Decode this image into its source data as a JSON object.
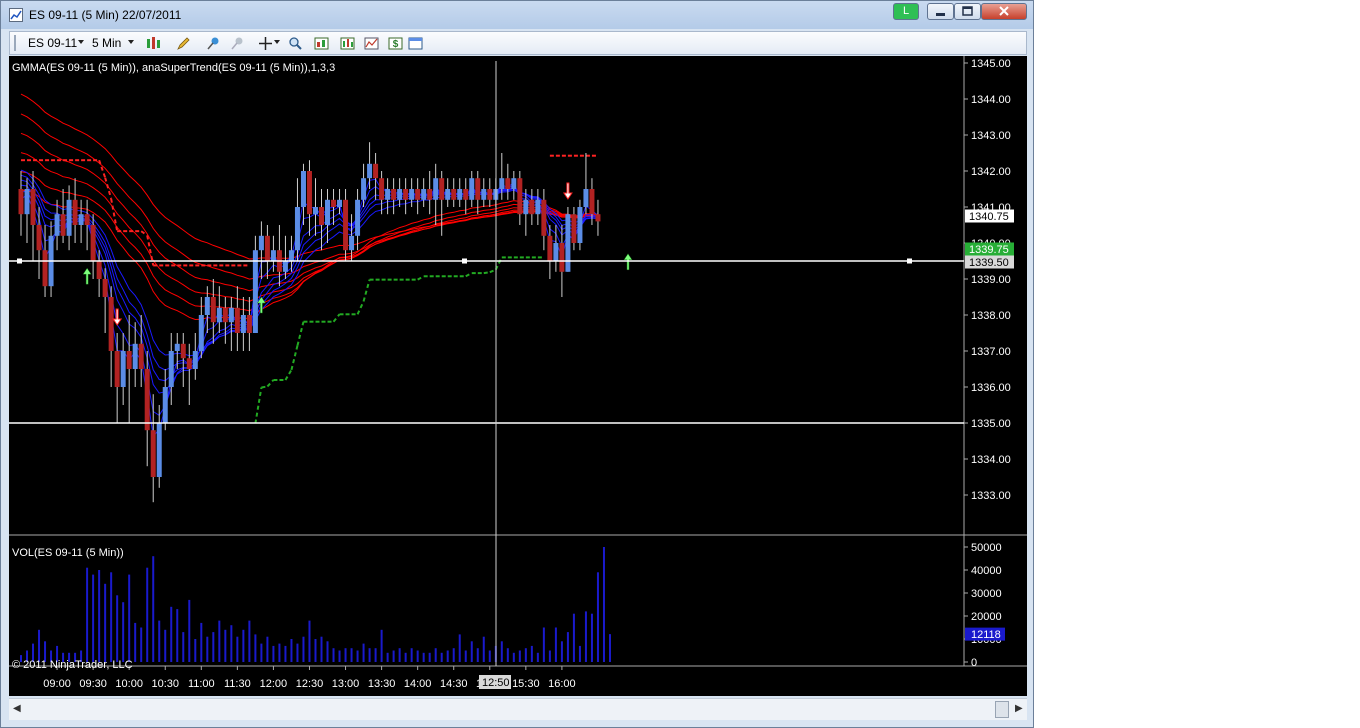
{
  "window": {
    "title": "ES 09-11 (5 Min)  22/07/2011",
    "link_button": "L",
    "min_icon": "minimize-icon",
    "max_icon": "maximize-icon",
    "close_icon": "close-icon"
  },
  "toolbar": {
    "instrument": "ES 09-11",
    "interval": "5 Min",
    "icons": [
      "bar-style-icon",
      "pencil-icon",
      "pin-icon",
      "pin-disabled-icon",
      "crosshair-icon",
      "zoom-icon",
      "chart-properties-icon",
      "indicators-icon",
      "strategies-icon",
      "dollar-icon",
      "data-box-icon"
    ]
  },
  "colors": {
    "background": "#000000",
    "up_candle": "#5b8de6",
    "down_candle": "#b22222",
    "gmma_short": "#1a1aff",
    "gmma_long": "#ff0000",
    "supertrend_up": "#22aa22",
    "supertrend_down": "#ff2222",
    "volume": "#1a1acc",
    "price_marker": "#d9d9d9",
    "supertrend_marker": "#27ae36",
    "volume_marker": "#1a1acc"
  },
  "price_panel": {
    "label": "GMMA(ES 09-11 (5 Min)), anaSuperTrend(ES 09-11 (5 Min)),1,3,3",
    "y_ticks": [
      "1345.00",
      "1344.00",
      "1343.00",
      "1342.00",
      "1341.00",
      "1340.00",
      "1339.00",
      "1338.00",
      "1337.00",
      "1336.00",
      "1335.00",
      "1334.00",
      "1333.00"
    ],
    "last_price": "1340.75",
    "supertrend_marker": "1339.75",
    "line_marker": "1339.50",
    "line_price": 1339.5,
    "line2_price": 1335.0
  },
  "volume_panel": {
    "label": "VOL(ES 09-11 (5 Min))",
    "y_ticks": [
      "50000",
      "40000",
      "30000",
      "20000",
      "10000",
      "0"
    ],
    "last_volume": "12118"
  },
  "x_axis": {
    "labels": [
      "09:00",
      "09:30",
      "10:00",
      "10:30",
      "11:00",
      "11:30",
      "12:00",
      "12:30",
      "13:00",
      "13:30",
      "14:00",
      "14:30",
      "15:00",
      "15:30",
      "16:00"
    ],
    "crosshair_time": "12:50"
  },
  "copyright": "© 2011 NinjaTrader, LLC",
  "chart_data": {
    "type": "candlestick",
    "ylim": [
      1332.5,
      1345.0
    ],
    "volume_ylim": [
      0,
      52000
    ],
    "candles": [
      [
        1341.5,
        1340.8,
        1342.0,
        1340.2
      ],
      [
        1340.8,
        1341.5,
        1341.8,
        1340.0
      ],
      [
        1341.5,
        1340.5,
        1342.0,
        1339.5
      ],
      [
        1340.5,
        1339.8,
        1341.0,
        1339.0
      ],
      [
        1339.8,
        1338.8,
        1340.5,
        1338.5
      ],
      [
        1338.8,
        1340.2,
        1340.6,
        1338.5
      ],
      [
        1340.2,
        1340.8,
        1341.2,
        1339.8
      ],
      [
        1340.8,
        1340.2,
        1341.5,
        1340.0
      ],
      [
        1340.2,
        1341.2,
        1341.6,
        1339.8
      ],
      [
        1341.2,
        1340.5,
        1341.8,
        1340.0
      ],
      [
        1340.5,
        1340.8,
        1341.2,
        1340.0
      ],
      [
        1340.8,
        1340.5,
        1341.2,
        1339.8
      ],
      [
        1340.5,
        1339.5,
        1340.8,
        1339.0
      ],
      [
        1339.5,
        1339.0,
        1339.8,
        1338.5
      ],
      [
        1339.0,
        1338.5,
        1339.3,
        1337.5
      ],
      [
        1338.5,
        1337.0,
        1338.8,
        1336.0
      ],
      [
        1337.0,
        1336.0,
        1337.5,
        1335.0
      ],
      [
        1336.0,
        1337.0,
        1337.5,
        1335.5
      ],
      [
        1337.0,
        1336.5,
        1338.0,
        1335.0
      ],
      [
        1336.5,
        1337.2,
        1337.8,
        1336.0
      ],
      [
        1337.2,
        1336.5,
        1338.0,
        1336.0
      ],
      [
        1336.5,
        1334.8,
        1337.0,
        1333.8
      ],
      [
        1334.8,
        1333.5,
        1335.8,
        1332.8
      ],
      [
        1333.5,
        1335.0,
        1335.5,
        1333.2
      ],
      [
        1335.0,
        1336.0,
        1336.5,
        1334.8
      ],
      [
        1336.0,
        1337.0,
        1337.5,
        1335.5
      ],
      [
        1337.0,
        1337.2,
        1337.5,
        1336.5
      ],
      [
        1337.2,
        1336.8,
        1337.5,
        1336.0
      ],
      [
        1336.8,
        1336.5,
        1337.2,
        1335.5
      ],
      [
        1336.5,
        1337.0,
        1337.5,
        1336.2
      ],
      [
        1337.0,
        1338.0,
        1338.5,
        1336.8
      ],
      [
        1338.0,
        1338.5,
        1338.8,
        1337.5
      ],
      [
        1338.5,
        1337.8,
        1339.0,
        1337.2
      ],
      [
        1337.8,
        1338.2,
        1338.8,
        1337.5
      ],
      [
        1338.2,
        1337.8,
        1338.5,
        1337.2
      ],
      [
        1337.8,
        1338.2,
        1338.5,
        1337.0
      ],
      [
        1338.2,
        1337.5,
        1338.8,
        1337.0
      ],
      [
        1337.5,
        1338.0,
        1338.5,
        1337.0
      ],
      [
        1338.0,
        1337.5,
        1338.5,
        1337.0
      ],
      [
        1337.5,
        1339.8,
        1340.2,
        1337.5
      ],
      [
        1339.8,
        1340.2,
        1340.6,
        1339.0
      ],
      [
        1340.2,
        1339.5,
        1340.5,
        1339.0
      ],
      [
        1339.5,
        1339.8,
        1340.2,
        1339.2
      ],
      [
        1339.8,
        1339.2,
        1340.5,
        1338.8
      ],
      [
        1339.2,
        1339.5,
        1340.2,
        1339.0
      ],
      [
        1339.5,
        1339.8,
        1340.2,
        1339.2
      ],
      [
        1339.8,
        1341.0,
        1341.8,
        1339.5
      ],
      [
        1341.0,
        1342.0,
        1342.2,
        1340.5
      ],
      [
        1342.0,
        1340.8,
        1342.3,
        1340.2
      ],
      [
        1340.8,
        1341.0,
        1341.8,
        1340.2
      ],
      [
        1341.0,
        1340.5,
        1341.5,
        1339.8
      ],
      [
        1340.5,
        1341.2,
        1341.5,
        1340.0
      ],
      [
        1341.2,
        1341.0,
        1341.5,
        1340.5
      ],
      [
        1341.0,
        1341.2,
        1341.5,
        1340.8
      ],
      [
        1341.2,
        1339.8,
        1341.5,
        1339.5
      ],
      [
        1339.8,
        1340.2,
        1340.8,
        1339.5
      ],
      [
        1340.2,
        1341.2,
        1341.5,
        1339.8
      ],
      [
        1341.2,
        1341.8,
        1342.2,
        1341.0
      ],
      [
        1341.8,
        1342.2,
        1342.8,
        1341.5
      ],
      [
        1342.2,
        1341.8,
        1342.5,
        1341.2
      ],
      [
        1341.8,
        1341.2,
        1342.0,
        1340.8
      ],
      [
        1341.2,
        1341.5,
        1341.8,
        1340.8
      ],
      [
        1341.5,
        1341.2,
        1341.8,
        1340.8
      ],
      [
        1341.2,
        1341.5,
        1341.8,
        1341.0
      ],
      [
        1341.5,
        1341.2,
        1341.8,
        1340.8
      ],
      [
        1341.2,
        1341.5,
        1341.8,
        1341.0
      ],
      [
        1341.5,
        1341.2,
        1341.8,
        1340.8
      ],
      [
        1341.2,
        1341.5,
        1341.8,
        1341.0
      ],
      [
        1341.5,
        1341.2,
        1342.0,
        1340.8
      ],
      [
        1341.2,
        1341.8,
        1342.2,
        1340.5
      ],
      [
        1341.8,
        1341.2,
        1342.0,
        1340.2
      ],
      [
        1341.2,
        1341.5,
        1341.8,
        1341.0
      ],
      [
        1341.5,
        1341.2,
        1341.8,
        1341.0
      ],
      [
        1341.2,
        1341.5,
        1341.8,
        1341.0
      ],
      [
        1341.5,
        1341.2,
        1341.8,
        1340.8
      ],
      [
        1341.2,
        1341.8,
        1342.0,
        1341.0
      ],
      [
        1341.8,
        1341.2,
        1342.0,
        1340.8
      ],
      [
        1341.2,
        1341.5,
        1341.8,
        1341.0
      ],
      [
        1341.5,
        1341.2,
        1341.8,
        1341.0
      ],
      [
        1341.2,
        1341.5,
        1341.8,
        1341.0
      ],
      [
        1341.5,
        1341.8,
        1342.5,
        1341.2
      ],
      [
        1341.8,
        1341.5,
        1342.2,
        1341.2
      ],
      [
        1341.5,
        1341.8,
        1342.0,
        1341.2
      ],
      [
        1341.8,
        1340.8,
        1342.0,
        1340.5
      ],
      [
        1340.8,
        1341.2,
        1341.5,
        1340.2
      ],
      [
        1341.2,
        1340.8,
        1341.5,
        1340.5
      ],
      [
        1340.8,
        1341.2,
        1341.5,
        1340.5
      ],
      [
        1341.2,
        1340.2,
        1341.5,
        1339.8
      ],
      [
        1340.2,
        1339.5,
        1340.5,
        1339.0
      ],
      [
        1339.5,
        1340.0,
        1340.5,
        1339.2
      ],
      [
        1340.0,
        1339.2,
        1340.5,
        1338.5
      ],
      [
        1339.2,
        1340.8,
        1341.0,
        1339.2
      ],
      [
        1340.8,
        1340.0,
        1341.0,
        1339.8
      ],
      [
        1340.0,
        1341.0,
        1341.2,
        1339.8
      ],
      [
        1341.0,
        1341.5,
        1342.5,
        1340.8
      ],
      [
        1341.5,
        1340.8,
        1341.8,
        1340.5
      ],
      [
        1340.8,
        1340.6,
        1341.2,
        1340.2
      ]
    ],
    "volume": [
      3000,
      5000,
      8000,
      14000,
      9000,
      5000,
      7000,
      4000,
      4000,
      4000,
      5000,
      41000,
      38000,
      40000,
      34000,
      39000,
      29000,
      26000,
      38000,
      17000,
      15000,
      41000,
      46000,
      18000,
      14000,
      24000,
      23000,
      13000,
      27000,
      10000,
      17000,
      11000,
      13000,
      18000,
      14000,
      16000,
      11000,
      14000,
      18000,
      12000,
      8000,
      11000,
      7000,
      8000,
      7000,
      10000,
      8000,
      11000,
      18000,
      10000,
      11000,
      9000,
      6000,
      5000,
      6000,
      6000,
      5000,
      8000,
      6000,
      6000,
      14000,
      4000,
      5000,
      6000,
      4000,
      6000,
      5000,
      4000,
      4000,
      6000,
      4000,
      5000,
      6000,
      12000,
      5000,
      9000,
      6000,
      11000,
      5000,
      7000,
      9000,
      6000,
      4000,
      5000,
      6000,
      7000,
      4000,
      15000,
      5000,
      15000,
      9000,
      13000,
      21000,
      7000,
      22000,
      21000,
      39000,
      50000,
      12118
    ],
    "supertrend_up_markers": [
      11,
      40,
      101
    ],
    "supertrend_down_markers": [
      16,
      91
    ]
  }
}
